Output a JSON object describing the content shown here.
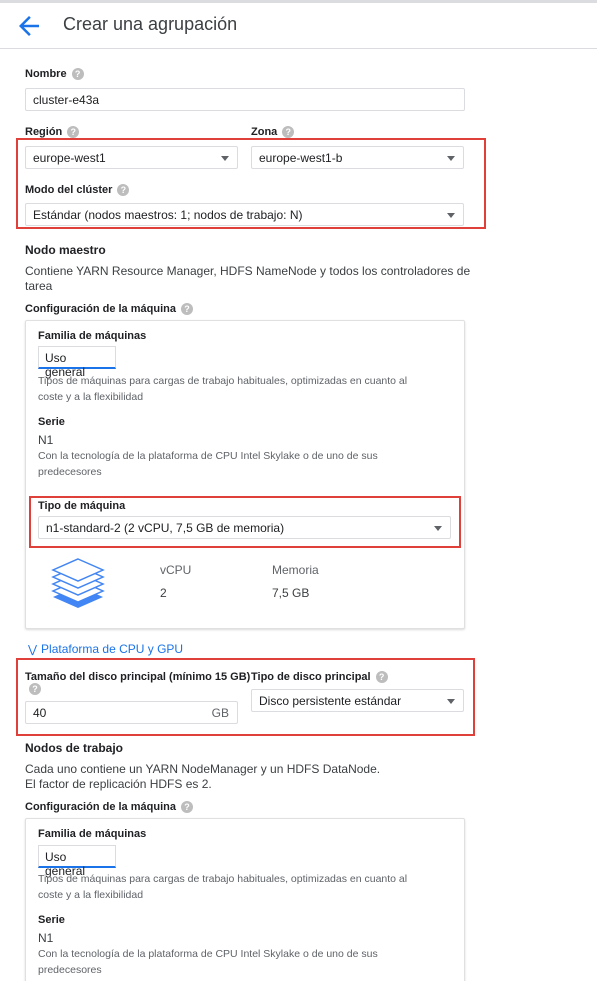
{
  "header": {
    "title": "Crear una agrupación"
  },
  "name": {
    "label": "Nombre",
    "value": "cluster-e43a"
  },
  "region": {
    "label": "Región",
    "value": "europe-west1"
  },
  "zone": {
    "label": "Zona",
    "value": "europe-west1-b"
  },
  "cluster_mode": {
    "label": "Modo del clúster",
    "value": "Estándar (nodos maestros: 1; nodos de trabajo: N)"
  },
  "master": {
    "heading": "Nodo maestro",
    "description_1": "Contiene YARN Resource Manager, HDFS NameNode y todos los controladores de",
    "description_2": "tarea",
    "machine_config_label": "Configuración de la máquina",
    "family_label": "Familia de máquinas",
    "family_button": "Uso general",
    "family_desc_1": "Tipos de máquinas para cargas de trabajo habituales, optimizadas en cuanto al",
    "family_desc_2": "coste y a la flexibilidad",
    "series_label": "Serie",
    "series_value": "N1",
    "series_desc_1": "Con la tecnología de la plataforma de CPU Intel Skylake o de uno de sus",
    "series_desc_2": "predecesores",
    "machine_type_label": "Tipo de máquina",
    "machine_type_value": "n1-standard-2 (2 vCPU, 7,5 GB de memoria)",
    "vcpu_label": "vCPU",
    "vcpu_value": "2",
    "memory_label": "Memoria",
    "memory_value": "7,5 GB",
    "cpu_gpu_link": "Plataforma de CPU y GPU",
    "disk_size_label": "Tamaño del disco principal (mínimo 15 GB)",
    "disk_size_value": "40",
    "disk_size_unit": "GB",
    "disk_type_label": "Tipo de disco principal",
    "disk_type_value": "Disco persistente estándar"
  },
  "workers": {
    "heading": "Nodos de trabajo",
    "description_1": "Cada uno contiene un YARN NodeManager y un HDFS DataNode.",
    "description_2": "El factor de replicación HDFS es 2.",
    "machine_config_label": "Configuración de la máquina",
    "family_label": "Familia de máquinas",
    "family_button": "Uso general",
    "family_desc_1": "Tipos de máquinas para cargas de trabajo habituales, optimizadas en cuanto al",
    "family_desc_2": "coste y a la flexibilidad",
    "series_label": "Serie",
    "series_value": "N1",
    "series_desc_1": "Con la tecnología de la plataforma de CPU Intel Skylake o de uno de sus",
    "series_desc_2": "predecesores"
  },
  "icons": {
    "back": "arrow-back-icon",
    "help": "help-circle-icon",
    "dropdown": "caret-down-icon",
    "expand": "double-chevron-down-icon",
    "machine": "stacked-layers-icon"
  },
  "colors": {
    "accent": "#1a73e8",
    "highlight": "#e0403a"
  }
}
